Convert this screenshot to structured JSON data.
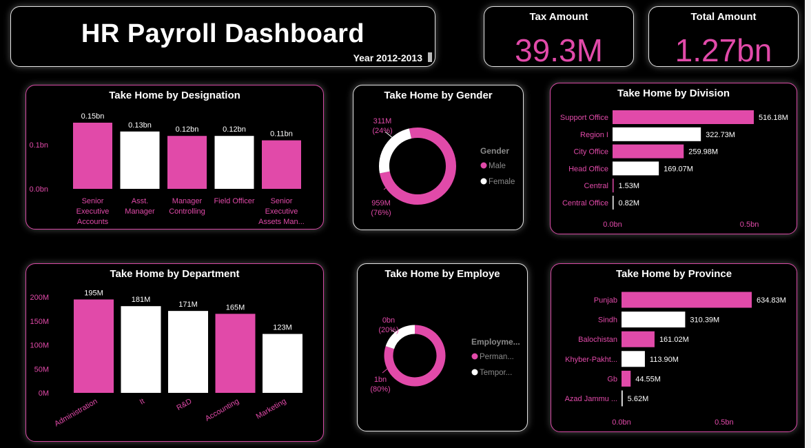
{
  "header": {
    "title": "HR Payroll Dashboard",
    "subtitle": "Year 2012-2013"
  },
  "kpis": {
    "tax": {
      "label": "Tax Amount",
      "value": "39.3M"
    },
    "total": {
      "label": "Total Amount",
      "value": "1.27bn"
    }
  },
  "colors": {
    "pink": "#e14aa9",
    "white": "#ffffff",
    "axis": "#e14aa9"
  },
  "chart_data": [
    {
      "id": "designation",
      "type": "bar",
      "title": "Take Home by Designation",
      "categories": [
        "Senior Executive Accounts",
        "Asst. Manager",
        "Manager Controlling",
        "Field Officer",
        "Senior Executive Assets Man..."
      ],
      "category_lines": [
        [
          "Senior",
          "Executive",
          "Accounts"
        ],
        [
          "Asst.",
          "Manager"
        ],
        [
          "Manager",
          "Controlling"
        ],
        [
          "Field Officer"
        ],
        [
          "Senior",
          "Executive",
          "Assets Man..."
        ]
      ],
      "values": [
        0.15,
        0.13,
        0.12,
        0.12,
        0.11
      ],
      "data_labels": [
        "0.15bn",
        "0.13bn",
        "0.12bn",
        "0.12bn",
        "0.11bn"
      ],
      "bar_colors": [
        "#e14aa9",
        "#ffffff",
        "#e14aa9",
        "#ffffff",
        "#e14aa9"
      ],
      "y_ticks": [
        0.0,
        0.1
      ],
      "y_tick_labels": [
        "0.0bn",
        "0.1bn"
      ],
      "ylim": [
        0,
        0.15
      ]
    },
    {
      "id": "gender",
      "type": "pie",
      "title": "Take Home by Gender",
      "legend_title": "Gender",
      "labels": [
        "Male",
        "Female"
      ],
      "values": [
        959,
        311
      ],
      "slice_value_labels": [
        "959M",
        "311M"
      ],
      "slice_pct_labels": [
        "(76%)",
        "(24%)"
      ],
      "colors": [
        "#e14aa9",
        "#ffffff"
      ]
    },
    {
      "id": "division",
      "type": "bar",
      "orientation": "horizontal",
      "title": "Take Home by Division",
      "categories": [
        "Support Office",
        "Region I",
        "City Office",
        "Head Office",
        "Central",
        "Central Office"
      ],
      "values": [
        516.18,
        322.73,
        259.98,
        169.07,
        1.53,
        0.82
      ],
      "data_labels": [
        "516.18M",
        "322.73M",
        "259.98M",
        "169.07M",
        "1.53M",
        "0.82M"
      ],
      "bar_colors": [
        "#e14aa9",
        "#ffffff",
        "#e14aa9",
        "#ffffff",
        "#e14aa9",
        "#ffffff"
      ],
      "x_ticks": [
        0,
        500
      ],
      "x_tick_labels": [
        "0.0bn",
        "0.5bn"
      ],
      "xlim": [
        0,
        516.18
      ]
    },
    {
      "id": "department",
      "type": "bar",
      "title": "Take Home by Department",
      "categories": [
        "Administration",
        "It",
        "R&D",
        "Accounting",
        "Marketing"
      ],
      "values": [
        195,
        181,
        171,
        165,
        123
      ],
      "data_labels": [
        "195M",
        "181M",
        "171M",
        "165M",
        "123M"
      ],
      "bar_colors": [
        "#e14aa9",
        "#ffffff",
        "#ffffff",
        "#e14aa9",
        "#ffffff"
      ],
      "y_ticks": [
        0,
        50,
        100,
        150,
        200
      ],
      "y_tick_labels": [
        "0M",
        "50M",
        "100M",
        "150M",
        "200M"
      ],
      "ylim": [
        0,
        200
      ]
    },
    {
      "id": "employee",
      "type": "pie",
      "title": "Take Home by Employe",
      "legend_title": "Employme...",
      "labels": [
        "Perman...",
        "Tempor..."
      ],
      "values": [
        80,
        20
      ],
      "slice_value_labels": [
        "1bn",
        "0bn"
      ],
      "slice_pct_labels": [
        "(80%)",
        "(20%)"
      ],
      "colors": [
        "#e14aa9",
        "#ffffff"
      ]
    },
    {
      "id": "province",
      "type": "bar",
      "orientation": "horizontal",
      "title": "Take Home by Province",
      "categories": [
        "Punjab",
        "Sindh",
        "Balochistan",
        "Khyber-Pakht...",
        "Gb",
        "Azad Jammu ..."
      ],
      "values": [
        634.83,
        310.39,
        161.02,
        113.9,
        44.55,
        5.62
      ],
      "data_labels": [
        "634.83M",
        "310.39M",
        "161.02M",
        "113.90M",
        "44.55M",
        "5.62M"
      ],
      "bar_colors": [
        "#e14aa9",
        "#ffffff",
        "#e14aa9",
        "#ffffff",
        "#e14aa9",
        "#ffffff"
      ],
      "x_ticks": [
        0,
        500
      ],
      "x_tick_labels": [
        "0.0bn",
        "0.5bn"
      ],
      "xlim": [
        0,
        634.83
      ]
    }
  ]
}
